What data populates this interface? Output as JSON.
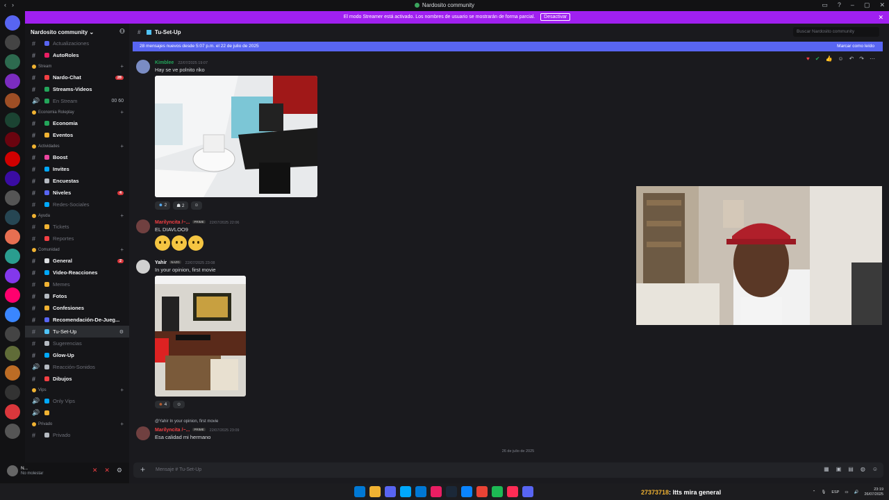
{
  "window": {
    "title": "Nardosito community",
    "controls": [
      "–",
      "▢",
      "✕"
    ]
  },
  "streamer_banner": {
    "text": "El modo Streamer está activado. Los nombres de usuario se mostrarán de forma parcial.",
    "button": "Desactivar",
    "close": "✕"
  },
  "server": {
    "name": "Nardosito community",
    "chevron": "⌄"
  },
  "channels": [
    {
      "type": "channel",
      "name": "Actualizaciones",
      "muted": true,
      "color": "#5865f2"
    },
    {
      "type": "channel",
      "name": "AutoRoles",
      "bold": true,
      "color": "#e91e63"
    },
    {
      "type": "category",
      "name": "Stream"
    },
    {
      "type": "channel",
      "name": "Nardo-Chat",
      "bold": true,
      "color": "#f23f43",
      "count": "28"
    },
    {
      "type": "channel",
      "name": "Streams-Videos",
      "bold": true,
      "color": "#23a55a"
    },
    {
      "type": "voice",
      "name": "En Stream",
      "muted": true,
      "color": "#23a55a",
      "right": "00  60"
    },
    {
      "type": "category",
      "name": "Economia Roleplay"
    },
    {
      "type": "channel",
      "name": "Economia",
      "bold": true,
      "color": "#23a55a"
    },
    {
      "type": "channel",
      "name": "Eventos",
      "bold": true,
      "color": "#f0b232"
    },
    {
      "type": "category",
      "name": "Actividades"
    },
    {
      "type": "channel",
      "name": "Boost",
      "bold": true,
      "color": "#eb459e"
    },
    {
      "type": "channel",
      "name": "Invites",
      "bold": true,
      "color": "#00a8fc"
    },
    {
      "type": "channel",
      "name": "Encuestas",
      "bold": true,
      "color": "#b5bac1"
    },
    {
      "type": "channel",
      "name": "Niveles",
      "bold": true,
      "color": "#5865f2",
      "count": "4"
    },
    {
      "type": "channel",
      "name": "Redes-Sociales",
      "muted": true,
      "color": "#00a8fc"
    },
    {
      "type": "category",
      "name": "Ayuda"
    },
    {
      "type": "channel",
      "name": "Tickets",
      "muted": true,
      "color": "#f0b232"
    },
    {
      "type": "channel",
      "name": "Reportes",
      "muted": true,
      "color": "#f23f43"
    },
    {
      "type": "category",
      "name": "Comunidad"
    },
    {
      "type": "channel",
      "name": "General",
      "bold": true,
      "color": "#dbdee1",
      "count": "2"
    },
    {
      "type": "channel",
      "name": "Video-Reacciones",
      "bold": true,
      "color": "#00a8fc"
    },
    {
      "type": "channel",
      "name": "Memes",
      "muted": true,
      "color": "#f0b232"
    },
    {
      "type": "channel",
      "name": "Fotos",
      "bold": true,
      "color": "#b5bac1"
    },
    {
      "type": "channel",
      "name": "Confesiones",
      "bold": true,
      "color": "#f0b232"
    },
    {
      "type": "channel",
      "name": "Recomendación-De-Jueg...",
      "bold": true,
      "color": "#5865f2"
    },
    {
      "type": "channel",
      "name": "Tu-Set-Up",
      "active": true,
      "color": "#4fc3f7"
    },
    {
      "type": "channel",
      "name": "Sugerencias",
      "muted": true,
      "color": "#b5bac1"
    },
    {
      "type": "channel",
      "name": "Glow-Up",
      "bold": true,
      "color": "#00a8fc"
    },
    {
      "type": "voice",
      "name": "Reacción-Sonidos",
      "muted": true,
      "color": "#b5bac1"
    },
    {
      "type": "channel",
      "name": "Dibujos",
      "bold": true,
      "color": "#f23f43"
    },
    {
      "type": "category",
      "name": "Vips"
    },
    {
      "type": "voice",
      "name": "Only Vips",
      "muted": true,
      "color": "#00a8fc"
    },
    {
      "type": "voice",
      "name": "",
      "muted": true,
      "color": "#f0b232"
    },
    {
      "type": "category",
      "name": "Privado"
    },
    {
      "type": "channel",
      "name": "Privado",
      "muted": true,
      "color": "#b5bac1"
    }
  ],
  "user": {
    "name": "N...",
    "status": "No molestar"
  },
  "header": {
    "channel": "Tu-Set-Up",
    "search_placeholder": "Buscar Nardosito community"
  },
  "new_messages": {
    "text": "28 mensajes nuevos desde 5:07 p.m. el 22 de julio de 2025",
    "mark": "Marcar como leído"
  },
  "messages": [
    {
      "author": "Kimblee",
      "color": "#23a55a",
      "timestamp": "22/07/2025 19:07",
      "text": "Hay se ve polnito riko",
      "reactions": [
        "2",
        "2"
      ]
    },
    {
      "author": "Marilyncita /~...",
      "color": "#f23f43",
      "tag": "PRIME",
      "timestamp": "22/07/2025 22:06",
      "text": "EL DIAVLOO9"
    },
    {
      "author": "Yahir",
      "color": "#f2f3f5",
      "tag": "NAZG",
      "timestamp": "22/07/2025 23:08",
      "text": "In your opinion, first movie",
      "reactions": [
        "4"
      ]
    },
    {
      "reply": "@Yahir  In your opinion, first movie",
      "author": "Marilyncita /~...",
      "color": "#f23f43",
      "tag": "PRIME",
      "timestamp": "22/07/2025 23:09",
      "text": "Esa calidad mi hermano"
    }
  ],
  "date_divider": "26 de julio de 2025",
  "composer": {
    "placeholder": "Mensaje #  Tu-Set-Up"
  },
  "taskbar": {
    "overlay_num": "27373718",
    "overlay_text": ": ltts mira general",
    "lang": "ESP",
    "time": "23:19",
    "date": "26/07/2025"
  }
}
